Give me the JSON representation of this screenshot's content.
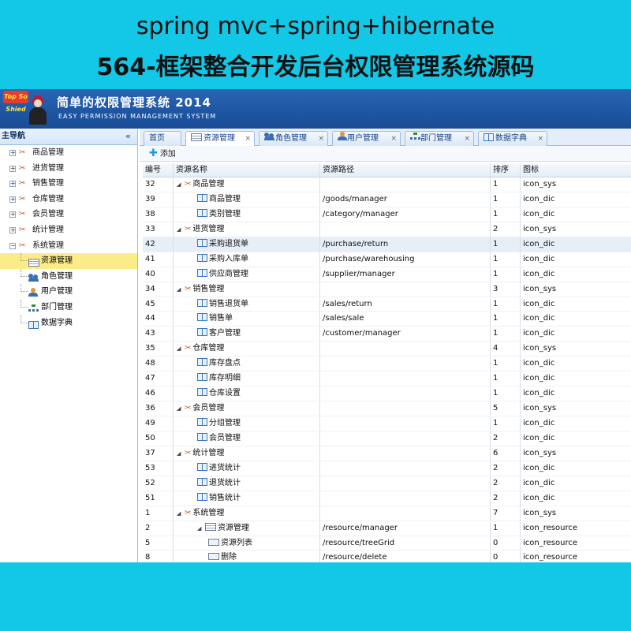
{
  "banner": {
    "line1": "spring mvc+spring+hibernate",
    "line2": "564-框架整合开发后台权限管理系统源码"
  },
  "app": {
    "logo_badge": "Top So Shied",
    "title": "简单的权限管理系统 2014",
    "subtitle": "EASY PERMISSION MANAGEMENT SYSTEM"
  },
  "sidebar": {
    "title": "主导航",
    "collapse_icon": "double-chevron-left-icon",
    "items": [
      {
        "label": "商品管理",
        "expanded": false
      },
      {
        "label": "进货管理",
        "expanded": false
      },
      {
        "label": "销售管理",
        "expanded": false
      },
      {
        "label": "仓库管理",
        "expanded": false
      },
      {
        "label": "会员管理",
        "expanded": false
      },
      {
        "label": "统计管理",
        "expanded": false
      },
      {
        "label": "系统管理",
        "expanded": true
      }
    ],
    "children": [
      {
        "label": "资源管理",
        "icon": "list-icon",
        "selected": true
      },
      {
        "label": "角色管理",
        "icon": "users-icon",
        "selected": false
      },
      {
        "label": "用户管理",
        "icon": "user-icon",
        "selected": false
      },
      {
        "label": "部门管理",
        "icon": "org-icon",
        "selected": false
      },
      {
        "label": "数据字典",
        "icon": "book-icon",
        "selected": false
      }
    ]
  },
  "tabs": [
    {
      "label": "首页",
      "icon": "",
      "closable": false,
      "active": false
    },
    {
      "label": "资源管理",
      "icon": "list-icon",
      "closable": true,
      "active": true
    },
    {
      "label": "角色管理",
      "icon": "users-icon",
      "closable": true,
      "active": false
    },
    {
      "label": "用户管理",
      "icon": "user-icon",
      "closable": true,
      "active": false
    },
    {
      "label": "部门管理",
      "icon": "org-icon",
      "closable": true,
      "active": false
    },
    {
      "label": "数据字典",
      "icon": "book-icon",
      "closable": true,
      "active": false
    }
  ],
  "toolbar": {
    "add_label": "添加"
  },
  "grid": {
    "columns": [
      "编号",
      "资源名称",
      "资源路径",
      "排序",
      "图标"
    ],
    "rows": [
      {
        "id": "32",
        "name": "商品管理",
        "path": "",
        "sort": "1",
        "icon": "icon_sys",
        "level": 0,
        "type": "tools",
        "expanded": true
      },
      {
        "id": "39",
        "name": "商品管理",
        "path": "/goods/manager",
        "sort": "1",
        "icon": "icon_dic",
        "level": 1,
        "type": "book"
      },
      {
        "id": "38",
        "name": "类别管理",
        "path": "/category/manager",
        "sort": "1",
        "icon": "icon_dic",
        "level": 1,
        "type": "book"
      },
      {
        "id": "33",
        "name": "进货管理",
        "path": "",
        "sort": "2",
        "icon": "icon_sys",
        "level": 0,
        "type": "tools",
        "expanded": true
      },
      {
        "id": "42",
        "name": "采购退货单",
        "path": "/purchase/return",
        "sort": "1",
        "icon": "icon_dic",
        "level": 1,
        "type": "book",
        "highlight": true
      },
      {
        "id": "41",
        "name": "采购入库单",
        "path": "/purchase/warehousing",
        "sort": "1",
        "icon": "icon_dic",
        "level": 1,
        "type": "book"
      },
      {
        "id": "40",
        "name": "供应商管理",
        "path": "/supplier/manager",
        "sort": "1",
        "icon": "icon_dic",
        "level": 1,
        "type": "book"
      },
      {
        "id": "34",
        "name": "销售管理",
        "path": "",
        "sort": "3",
        "icon": "icon_sys",
        "level": 0,
        "type": "tools",
        "expanded": true
      },
      {
        "id": "45",
        "name": "销售退货单",
        "path": "/sales/return",
        "sort": "1",
        "icon": "icon_dic",
        "level": 1,
        "type": "book"
      },
      {
        "id": "44",
        "name": "销售单",
        "path": "/sales/sale",
        "sort": "1",
        "icon": "icon_dic",
        "level": 1,
        "type": "book"
      },
      {
        "id": "43",
        "name": "客户管理",
        "path": "/customer/manager",
        "sort": "1",
        "icon": "icon_dic",
        "level": 1,
        "type": "book"
      },
      {
        "id": "35",
        "name": "仓库管理",
        "path": "",
        "sort": "4",
        "icon": "icon_sys",
        "level": 0,
        "type": "tools",
        "expanded": true
      },
      {
        "id": "48",
        "name": "库存盘点",
        "path": "",
        "sort": "1",
        "icon": "icon_dic",
        "level": 1,
        "type": "book"
      },
      {
        "id": "47",
        "name": "库存明细",
        "path": "",
        "sort": "1",
        "icon": "icon_dic",
        "level": 1,
        "type": "book"
      },
      {
        "id": "46",
        "name": "仓库设置",
        "path": "",
        "sort": "1",
        "icon": "icon_dic",
        "level": 1,
        "type": "book"
      },
      {
        "id": "36",
        "name": "会员管理",
        "path": "",
        "sort": "5",
        "icon": "icon_sys",
        "level": 0,
        "type": "tools",
        "expanded": true
      },
      {
        "id": "49",
        "name": "分组管理",
        "path": "",
        "sort": "1",
        "icon": "icon_dic",
        "level": 1,
        "type": "book"
      },
      {
        "id": "50",
        "name": "会员管理",
        "path": "",
        "sort": "2",
        "icon": "icon_dic",
        "level": 1,
        "type": "book"
      },
      {
        "id": "37",
        "name": "统计管理",
        "path": "",
        "sort": "6",
        "icon": "icon_sys",
        "level": 0,
        "type": "tools",
        "expanded": true
      },
      {
        "id": "53",
        "name": "进货统计",
        "path": "",
        "sort": "2",
        "icon": "icon_dic",
        "level": 1,
        "type": "book"
      },
      {
        "id": "52",
        "name": "退货统计",
        "path": "",
        "sort": "2",
        "icon": "icon_dic",
        "level": 1,
        "type": "book"
      },
      {
        "id": "51",
        "name": "销售统计",
        "path": "",
        "sort": "2",
        "icon": "icon_dic",
        "level": 1,
        "type": "book"
      },
      {
        "id": "1",
        "name": "系统管理",
        "path": "",
        "sort": "7",
        "icon": "icon_sys",
        "level": 0,
        "type": "tools",
        "expanded": true
      },
      {
        "id": "2",
        "name": "资源管理",
        "path": "/resource/manager",
        "sort": "1",
        "icon": "icon_resource",
        "level": 1,
        "type": "list",
        "expanded": true
      },
      {
        "id": "5",
        "name": "资源列表",
        "path": "/resource/treeGrid",
        "sort": "0",
        "icon": "icon_resource",
        "level": 2,
        "type": "item"
      },
      {
        "id": "8",
        "name": "删除",
        "path": "/resource/delete",
        "sort": "0",
        "icon": "icon_resource",
        "level": 2,
        "type": "item"
      }
    ]
  },
  "colors": {
    "background": "#12c8e6",
    "header": "#1e55a2",
    "selected": "#fbec88"
  }
}
